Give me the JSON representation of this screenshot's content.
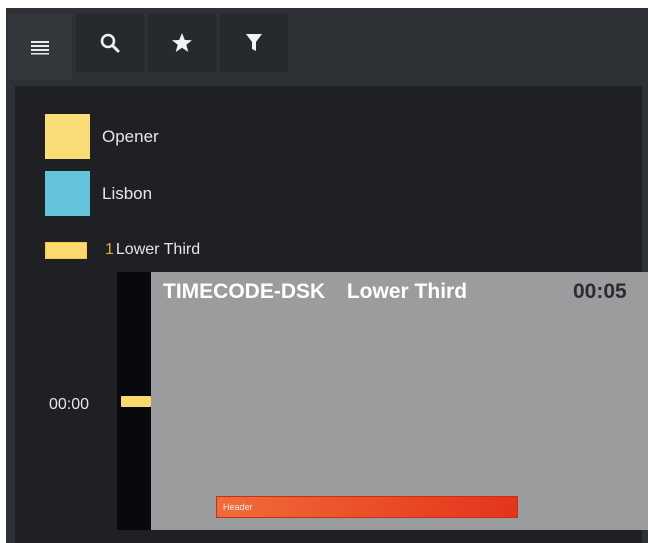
{
  "toolbar": {
    "tabs": [
      {
        "name": "menu",
        "icon": "menu-icon"
      },
      {
        "name": "search",
        "icon": "search-icon"
      },
      {
        "name": "favorites",
        "icon": "star-icon"
      },
      {
        "name": "filter",
        "icon": "filter-icon"
      }
    ]
  },
  "legend": {
    "items": [
      {
        "label": "Opener",
        "color": "#fbdd77"
      },
      {
        "label": "Lisbon",
        "color": "#64c3db"
      }
    ]
  },
  "lower_third_row": {
    "number": "1",
    "label": "Lower Third",
    "color": "#fbd96d"
  },
  "timeline": {
    "start_time": "00:00"
  },
  "preview": {
    "channel": "TIMECODE-DSK",
    "title": "Lower Third",
    "duration": "00:05",
    "header_label": "Header"
  }
}
